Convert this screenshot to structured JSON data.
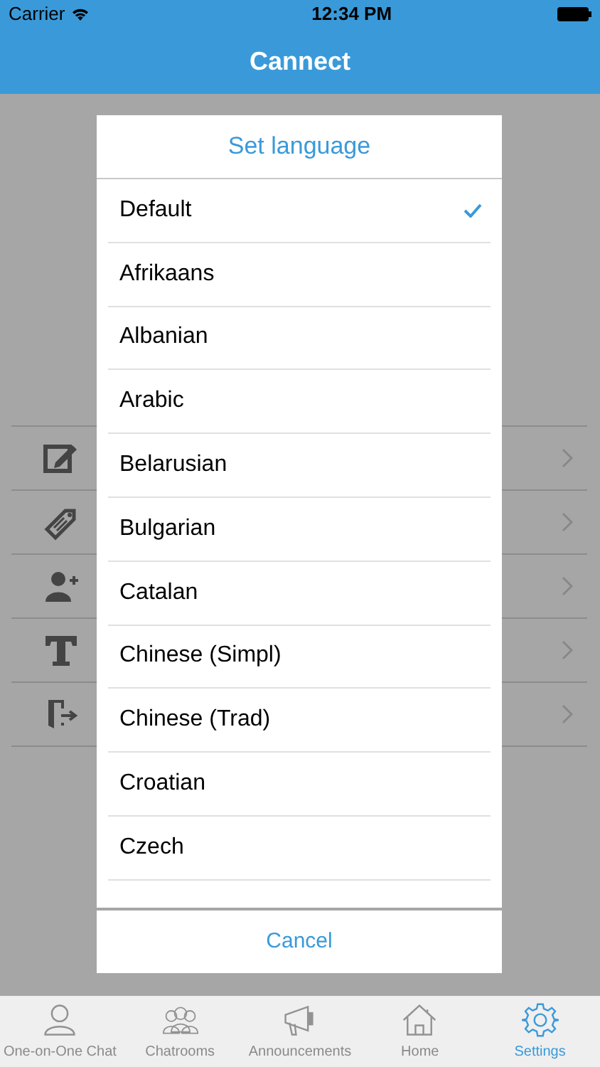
{
  "status_bar": {
    "carrier": "Carrier",
    "time": "12:34 PM"
  },
  "nav": {
    "title": "Cannect"
  },
  "dialog": {
    "title": "Set language",
    "options": [
      {
        "label": "Default",
        "selected": true
      },
      {
        "label": "Afrikaans",
        "selected": false
      },
      {
        "label": "Albanian",
        "selected": false
      },
      {
        "label": "Arabic",
        "selected": false
      },
      {
        "label": "Belarusian",
        "selected": false
      },
      {
        "label": "Bulgarian",
        "selected": false
      },
      {
        "label": "Catalan",
        "selected": false
      },
      {
        "label": "Chinese (Simpl)",
        "selected": false
      },
      {
        "label": "Chinese (Trad)",
        "selected": false
      },
      {
        "label": "Croatian",
        "selected": false
      },
      {
        "label": "Czech",
        "selected": false
      }
    ],
    "cancel": "Cancel"
  },
  "tab_bar": [
    {
      "label": "One-on-One Chat",
      "selected": false
    },
    {
      "label": "Chatrooms",
      "selected": false
    },
    {
      "label": "Announcements",
      "selected": false
    },
    {
      "label": "Home",
      "selected": false
    },
    {
      "label": "Settings",
      "selected": true
    }
  ]
}
